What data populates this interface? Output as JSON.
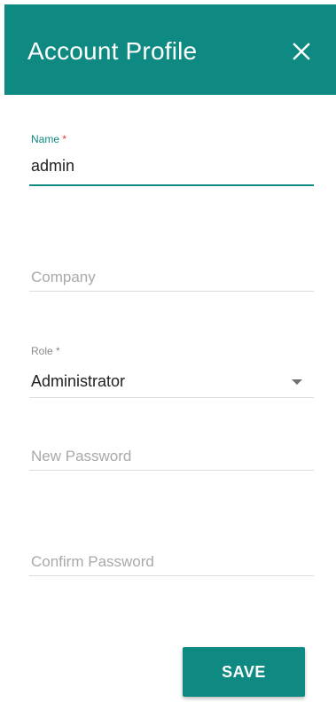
{
  "dialog": {
    "title": "Account Profile"
  },
  "form": {
    "name": {
      "label": "Name",
      "required_mark": "*",
      "value": "admin"
    },
    "company": {
      "placeholder": "Company"
    },
    "role": {
      "label": "Role",
      "required_mark": "*",
      "value": "Administrator"
    },
    "new_password": {
      "placeholder": "New Password"
    },
    "confirm_password": {
      "placeholder": "Confirm Password"
    }
  },
  "actions": {
    "save_label": "SAVE"
  },
  "colors": {
    "accent": "#0f8a82",
    "required": "#e53935"
  }
}
